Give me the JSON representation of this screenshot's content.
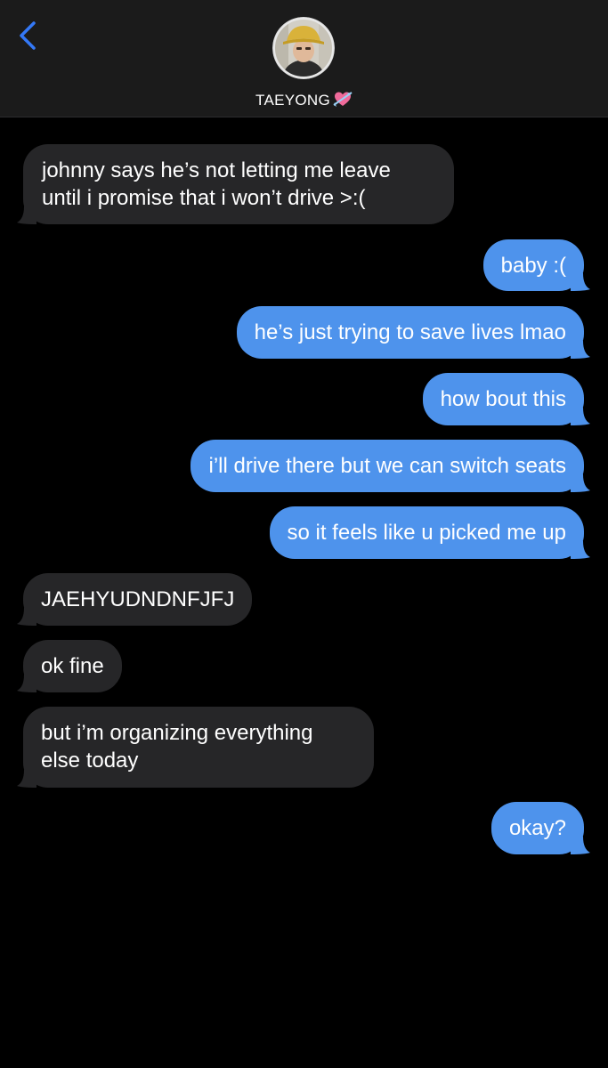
{
  "header": {
    "contact_name": "TAEYONG",
    "name_emoji": "heart-with-arrow",
    "back_icon": "chevron-left-icon",
    "accent": "#3478f6"
  },
  "colors": {
    "incoming_bubble": "#262628",
    "outgoing_bubble": "#4e93ec",
    "background": "#000000",
    "header_background": "#1b1b1b"
  },
  "messages": [
    {
      "direction": "incoming",
      "lines": [
        "johnny says he’s not letting me leave",
        "until i promise that i won’t drive >:("
      ]
    },
    {
      "direction": "outgoing",
      "lines": [
        "baby :("
      ]
    },
    {
      "direction": "outgoing",
      "lines": [
        "he’s just trying to save lives lmao"
      ]
    },
    {
      "direction": "outgoing",
      "lines": [
        "how bout this"
      ]
    },
    {
      "direction": "outgoing",
      "lines": [
        "i’ll drive there but we can switch seats"
      ]
    },
    {
      "direction": "outgoing",
      "lines": [
        "so it feels like u picked me up"
      ]
    },
    {
      "direction": "incoming",
      "lines": [
        "JAEHYUDNDNFJFJ"
      ]
    },
    {
      "direction": "incoming",
      "lines": [
        "ok fine"
      ]
    },
    {
      "direction": "incoming",
      "lines": [
        "but i’m organizing everything",
        "else today"
      ]
    },
    {
      "direction": "outgoing",
      "lines": [
        "okay?"
      ]
    }
  ]
}
